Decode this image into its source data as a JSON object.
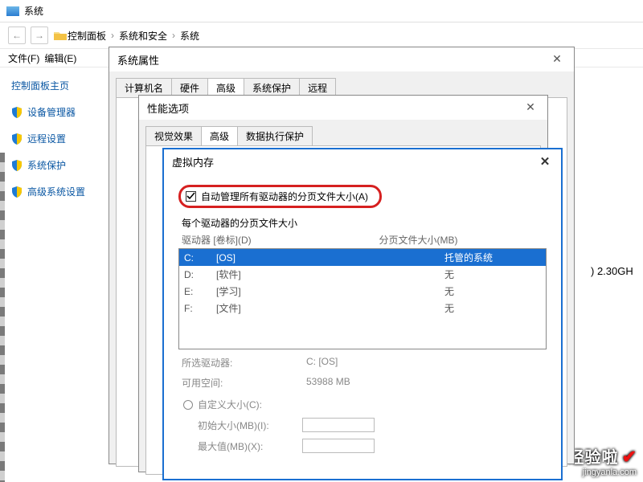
{
  "window": {
    "title": "系统"
  },
  "breadcrumb": {
    "items": [
      "控制面板",
      "系统和安全",
      "系统"
    ]
  },
  "menu": {
    "file": "文件(F)",
    "edit": "编辑(E)"
  },
  "sidebar": {
    "title": "控制面板主页",
    "items": [
      {
        "label": "设备管理器"
      },
      {
        "label": "远程设置"
      },
      {
        "label": "系统保护"
      },
      {
        "label": "高级系统设置"
      }
    ]
  },
  "main": {
    "cpu_ghz": ") 2.30GH"
  },
  "dlg_sysprops": {
    "title": "系统属性",
    "tabs": [
      "计算机名",
      "硬件",
      "高级",
      "系统保护",
      "远程"
    ],
    "active_tab": "高级"
  },
  "dlg_perf": {
    "title": "性能选项",
    "tabs": [
      "视觉效果",
      "高级",
      "数据执行保护"
    ],
    "active_tab": "高级"
  },
  "dlg_vm": {
    "title": "虚拟内存",
    "auto_label": "自动管理所有驱动器的分页文件大小(A)",
    "auto_checked": true,
    "per_drive_label": "每个驱动器的分页文件大小",
    "col1": "驱动器 [卷标](D)",
    "col2": "分页文件大小(MB)",
    "drives": [
      {
        "letter": "C:",
        "label": "[OS]",
        "size": "托管的系统",
        "selected": true
      },
      {
        "letter": "D:",
        "label": "[软件]",
        "size": "无"
      },
      {
        "letter": "E:",
        "label": "[学习]",
        "size": "无"
      },
      {
        "letter": "F:",
        "label": "[文件]",
        "size": "无"
      }
    ],
    "selected_drive_label": "所选驱动器:",
    "selected_drive_value": "C:  [OS]",
    "free_space_label": "可用空间:",
    "free_space_value": "53988 MB",
    "custom_label": "自定义大小(C):",
    "initial_label": "初始大小(MB)(I):",
    "max_label": "最大值(MB)(X):"
  },
  "watermark": {
    "brand": "经验啦",
    "url": "jingyanla.com"
  }
}
